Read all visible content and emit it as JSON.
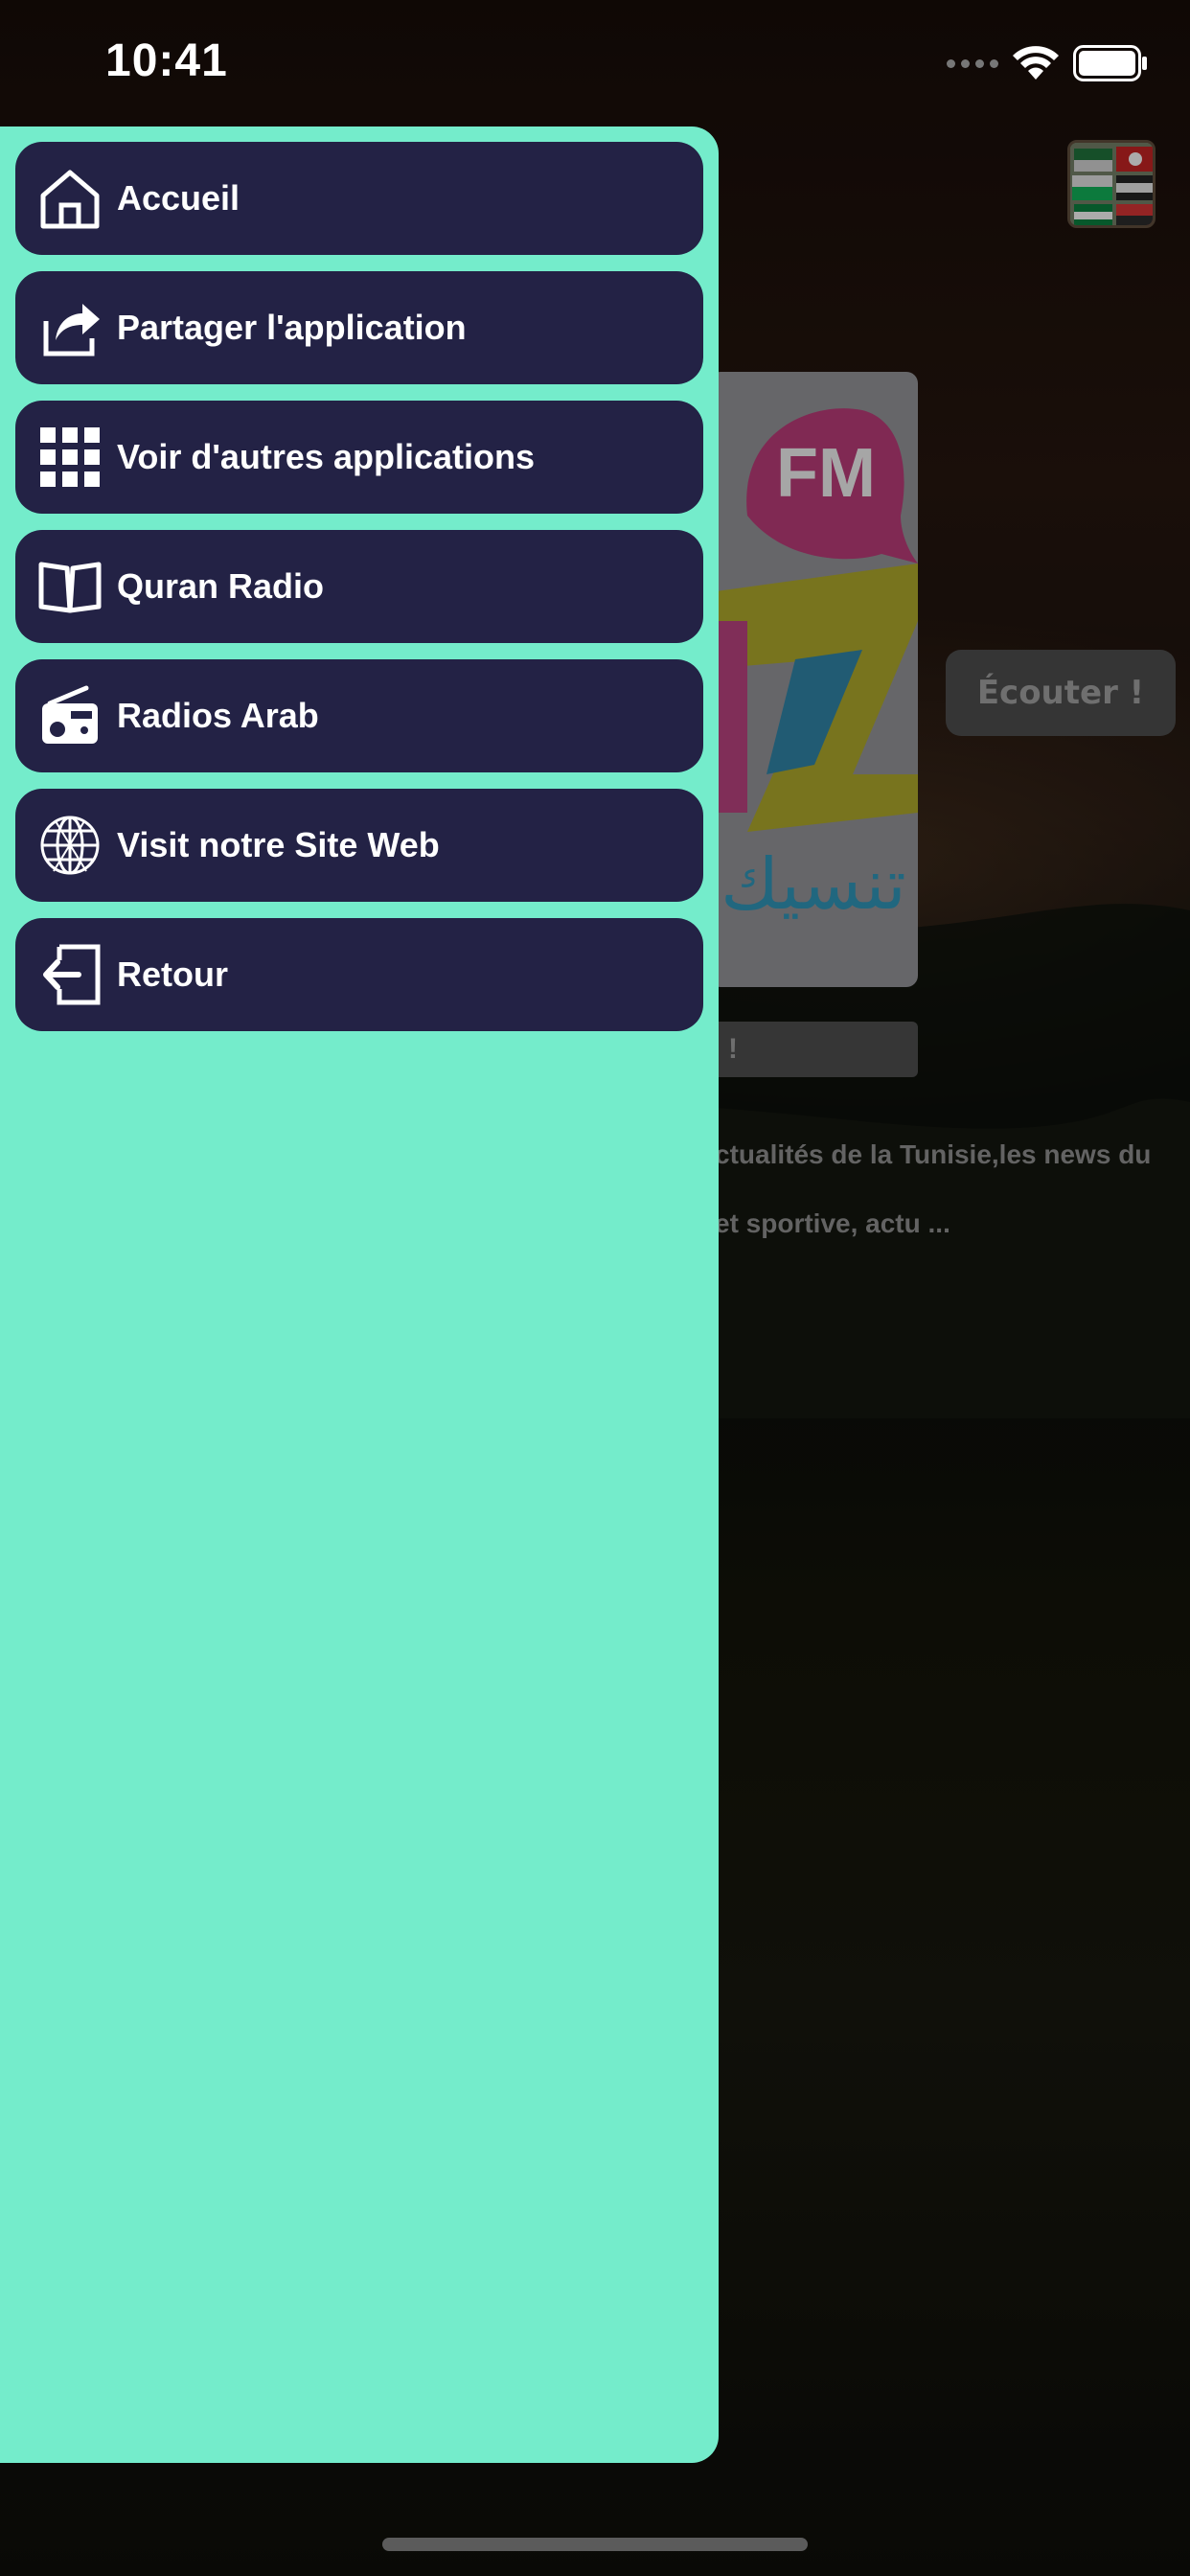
{
  "status_bar": {
    "time": "10:41"
  },
  "menu": {
    "items": [
      {
        "label": "Accueil",
        "icon": "home-icon"
      },
      {
        "label": "Partager l'application",
        "icon": "share-icon"
      },
      {
        "label": "Voir d'autres applications",
        "icon": "apps-grid-icon"
      },
      {
        "label": "Quran Radio",
        "icon": "open-book-icon"
      },
      {
        "label": "Radios Arab",
        "icon": "radio-icon"
      },
      {
        "label": "Visit notre Site Web",
        "icon": "globe-icon"
      },
      {
        "label": "Retour",
        "icon": "exit-icon"
      }
    ]
  },
  "background": {
    "listen_label": "Écouter !",
    "small_button_label": "!",
    "description_line_1": "ctualités de la Tunisie,les news du",
    "description_line_2": "et sportive, actu ...",
    "logo": {
      "badge_text": "FM",
      "arabic_text": "تنسيك"
    }
  },
  "colors": {
    "menu_background": "#74eccb",
    "menu_item_background": "#232245",
    "menu_item_text": "#ffffff"
  }
}
